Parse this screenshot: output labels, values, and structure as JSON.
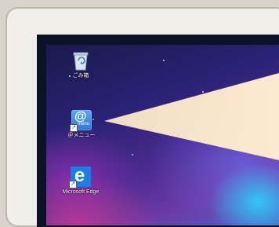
{
  "desktop": {
    "icons": [
      {
        "label": "ごみ箱",
        "icon": "recycle-bin-icon"
      },
      {
        "label": "＠メニュー",
        "icon": "at-menu-icon",
        "glyph_text": "@",
        "glyph_subtext": "menu"
      },
      {
        "label": "Microsoft Edge",
        "icon": "edge-icon",
        "glyph_text": "e"
      }
    ]
  },
  "colors": {
    "frame": "#f1efea",
    "bezel": "#0c1226",
    "callout": "#fbe6c8"
  }
}
